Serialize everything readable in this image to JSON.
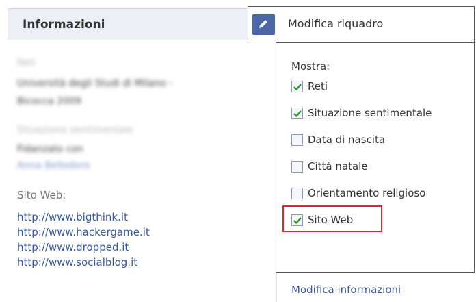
{
  "info": {
    "title": "Informazioni",
    "blurred": {
      "networks_label": "Reti",
      "networks_value_line1": "Università degli Studi di Milano -",
      "networks_value_line2": "Bicocca 2009",
      "relationship_label": "Situazione sentimentale",
      "relationship_value": "Fidanzato con",
      "relationship_link": "Anna Bellodoro"
    },
    "website_label": "Sito Web:",
    "websites": [
      "http://www.bigthink.it",
      "http://www.hackergame.it",
      "http://www.dropped.it",
      "http://www.socialblog.it"
    ]
  },
  "panel": {
    "header_label": "Modifica riquadro",
    "header_icon": "pencil-icon",
    "show_label": "Mostra:",
    "options": [
      {
        "label": "Reti",
        "checked": true
      },
      {
        "label": "Situazione sentimentale",
        "checked": true
      },
      {
        "label": "Data di nascita",
        "checked": false
      },
      {
        "label": "Città natale",
        "checked": false
      },
      {
        "label": "Orientamento religioso",
        "checked": false
      },
      {
        "label": "Sito Web",
        "checked": true
      }
    ],
    "edit_link": "Modifica informazioni"
  },
  "colors": {
    "header_bg": "#eceff5",
    "link": "#3b5998",
    "check": "#2a9a2a",
    "highlight": "#e0262b",
    "button": "#4a66a5"
  }
}
